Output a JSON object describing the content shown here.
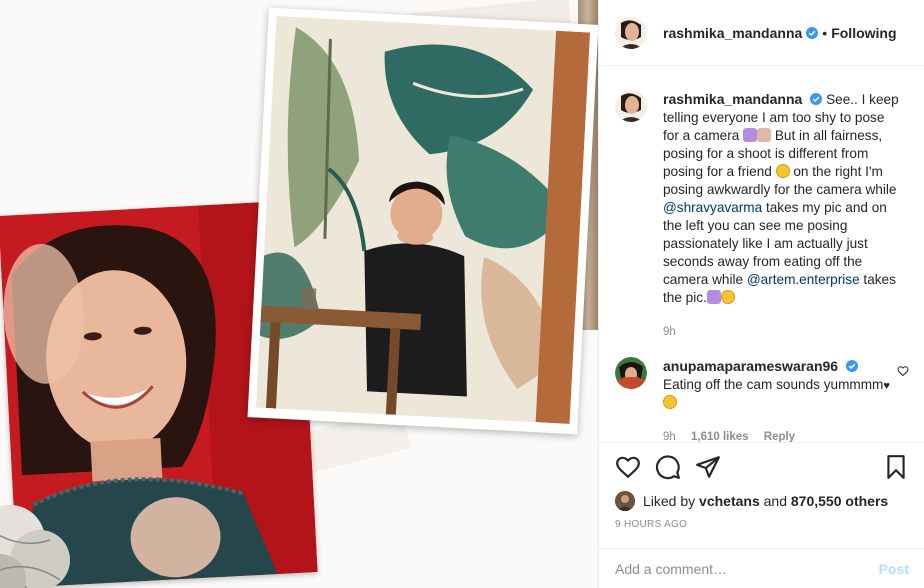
{
  "post": {
    "username": "rashmika_mandanna",
    "follow_status": "Following",
    "separator": "•"
  },
  "caption": {
    "username": "rashmika_mandanna",
    "text_1": "See.. I keep telling everyone I am too shy to pose for a camera ",
    "text_2": " But in all fairness, posing for a shoot is different from posing for a friend ",
    "text_3": " on the right I'm posing awkwardly for the camera while ",
    "mention_1": "@shravyavarma",
    "text_4": " takes my pic and on the left you can see me posing passionately like I am actually just seconds away from eating off the camera while ",
    "mention_2": "@artem.enterprise",
    "text_5": " takes the pic.",
    "time": "9h"
  },
  "comment": {
    "username": "anupamaparameswaran96",
    "text": "Eating off the cam sounds yummmm",
    "heart": "♥",
    "time": "9h",
    "likes": "1,610 likes",
    "reply": "Reply"
  },
  "actions": {
    "liked_by_prefix": "Liked by ",
    "liked_by_user": "vchetans",
    "liked_by_and": " and ",
    "liked_by_count": "870,550 others",
    "time_ago": "9 HOURS AGO"
  },
  "add_comment": {
    "placeholder": "Add a comment…",
    "post_label": "Post"
  },
  "colors": {
    "verified": "#3897f0",
    "mention": "#00376b",
    "post_disabled": "#b2dffc"
  }
}
